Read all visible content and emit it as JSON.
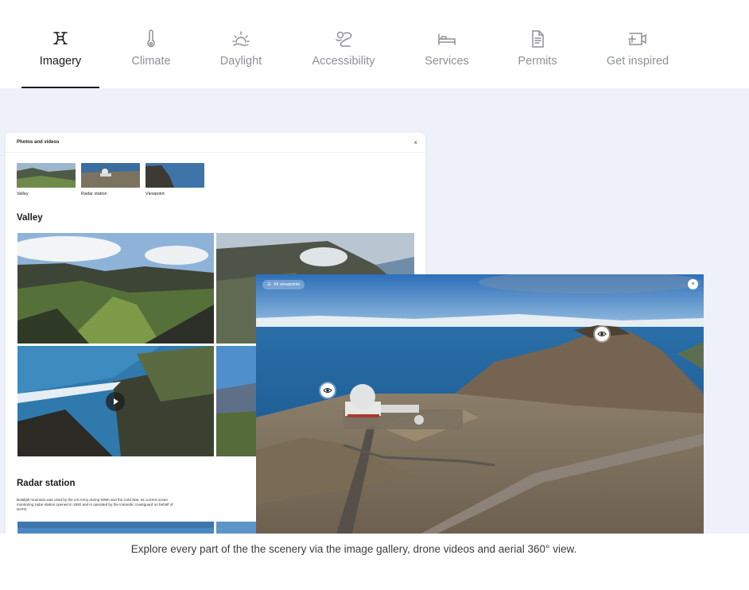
{
  "tabs": [
    {
      "label": "Imagery",
      "icon": "drone-icon",
      "active": true
    },
    {
      "label": "Climate",
      "icon": "thermometer-icon",
      "active": false
    },
    {
      "label": "Daylight",
      "icon": "sunrise-icon",
      "active": false
    },
    {
      "label": "Accessibility",
      "icon": "road-map-icon",
      "active": false
    },
    {
      "label": "Services",
      "icon": "bed-icon",
      "active": false
    },
    {
      "label": "Permits",
      "icon": "document-icon",
      "active": false
    },
    {
      "label": "Get inspired",
      "icon": "video-add-icon",
      "active": false
    }
  ],
  "gallery": {
    "title": "Photos and videos",
    "close": "×",
    "thumbnails": [
      {
        "label": "Valley"
      },
      {
        "label": "Radar station"
      },
      {
        "label": "Viewpoint"
      }
    ],
    "sections": {
      "valley": {
        "title": "Valley"
      },
      "radar": {
        "title": "Radar station",
        "description": "Bolafjall mountain was used by the US Army during WWII and the Cold War. Its current ocean monitoring radar station opened in 1992 and is operated by the Icelandic coastguard on behalf of NATO."
      }
    }
  },
  "viewer": {
    "all_viewpoints": "All viewpoints",
    "close": "×"
  },
  "caption": "Explore every part of the the scenery via the image gallery, drone videos and aerial 360° view.",
  "colors": {
    "stage_bg": "#eef1f9",
    "active_tab": "#1b1b1f",
    "inactive_tab": "#8e9097"
  }
}
